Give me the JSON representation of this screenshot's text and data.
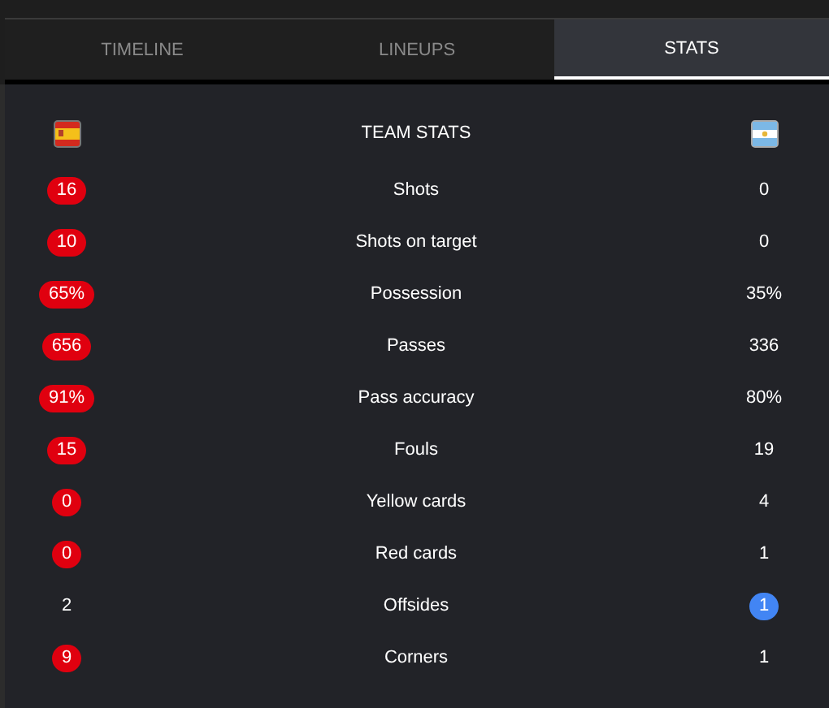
{
  "tabs": [
    {
      "label": "TIMELINE",
      "selected": false
    },
    {
      "label": "LINEUPS",
      "selected": false
    },
    {
      "label": "STATS",
      "selected": true
    }
  ],
  "teams": [
    {
      "color": "#e0000f"
    },
    {
      "color": "#4285f4"
    }
  ],
  "header": "TEAM STATS",
  "stats": [
    {
      "label": "Shots",
      "home": "16",
      "away": "0",
      "home_highlighted": true,
      "away_highlighted": false
    },
    {
      "label": "Shots on target",
      "home": "10",
      "away": "0",
      "home_highlighted": true,
      "away_highlighted": false
    },
    {
      "label": "Possession",
      "home": "65%",
      "away": "35%",
      "home_highlighted": true,
      "away_highlighted": false
    },
    {
      "label": "Passes",
      "home": "656",
      "away": "336",
      "home_highlighted": true,
      "away_highlighted": false
    },
    {
      "label": "Pass accuracy",
      "home": "91%",
      "away": "80%",
      "home_highlighted": true,
      "away_highlighted": false
    },
    {
      "label": "Fouls",
      "home": "15",
      "away": "19",
      "home_highlighted": true,
      "away_highlighted": false
    },
    {
      "label": "Yellow cards",
      "home": "0",
      "away": "4",
      "home_highlighted": true,
      "away_highlighted": false
    },
    {
      "label": "Red cards",
      "home": "0",
      "away": "1",
      "home_highlighted": true,
      "away_highlighted": false
    },
    {
      "label": "Offsides",
      "home": "2",
      "away": "1",
      "home_highlighted": false,
      "away_highlighted": true
    },
    {
      "label": "Corners",
      "home": "9",
      "away": "1",
      "home_highlighted": true,
      "away_highlighted": false
    }
  ]
}
